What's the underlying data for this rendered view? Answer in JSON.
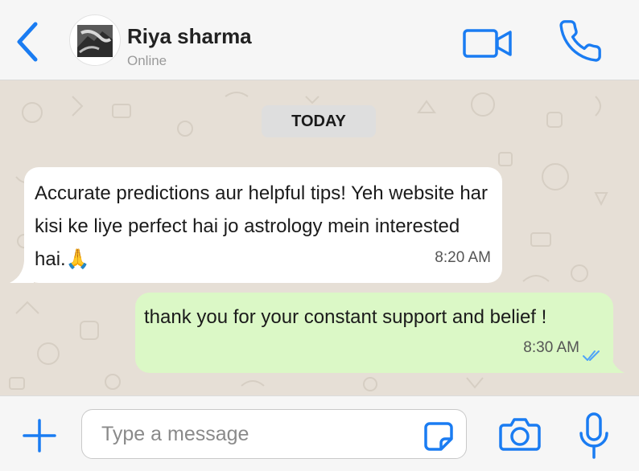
{
  "header": {
    "contact_name": "Riya sharma",
    "status": "Online"
  },
  "chat": {
    "date_divider": "TODAY",
    "messages": [
      {
        "direction": "incoming",
        "text": "Accurate predictions aur helpful tips! Yeh website har kisi ke liye perfect hai jo astrology mein interested hai.🙏",
        "time": "8:20 AM"
      },
      {
        "direction": "outgoing",
        "text": "thank you for your constant support and belief !",
        "time": "8:30 AM",
        "read": true
      }
    ]
  },
  "composer": {
    "placeholder": "Type a message"
  },
  "colors": {
    "accent": "#1a7cf2",
    "chat_background": "#e6dfd6",
    "incoming_bubble": "#ffffff",
    "outgoing_bubble": "#dbf8c6",
    "read_ticks": "#4fa3f7"
  },
  "icons": {
    "back": "chevron-left-icon",
    "video": "video-camera-icon",
    "call": "phone-icon",
    "attach": "plus-icon",
    "sticker": "sticker-icon",
    "camera": "camera-icon",
    "mic": "microphone-icon",
    "read": "double-check-icon"
  }
}
